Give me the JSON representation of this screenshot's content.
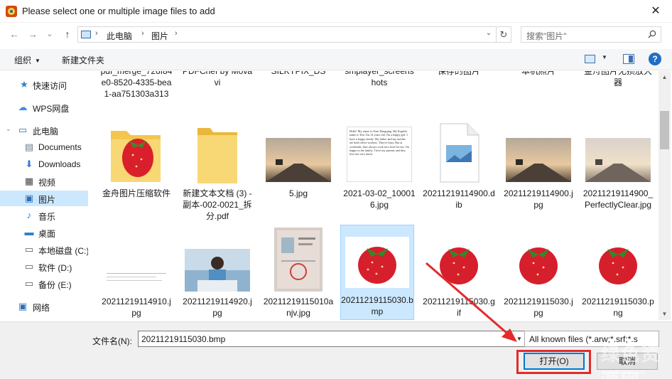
{
  "window": {
    "title": "Please select one or multiple image files to add",
    "close_symbol": "✕"
  },
  "nav": {
    "back_symbol": "←",
    "forward_symbol": "→",
    "recent_symbol": "⌄",
    "up_symbol": "↑",
    "breadcrumb": [
      "此电脑",
      "图片"
    ],
    "breadcrumb_sep": "›",
    "refresh_symbol": "↻",
    "dropdown_symbol": "⌄",
    "search_placeholder": "搜索\"图片\""
  },
  "toolbar": {
    "organize_label": "组织",
    "organize_caret": "▼",
    "new_folder_label": "新建文件夹",
    "view_dd_symbol": "▼",
    "help_symbol": "?"
  },
  "sidebar": {
    "items": [
      {
        "label": "快速访问",
        "icon": "star-icon",
        "glyph": "★"
      },
      {
        "label": "WPS网盘",
        "icon": "cloud-icon",
        "glyph": "☁"
      },
      {
        "label": "此电脑",
        "icon": "computer-icon",
        "glyph": "▭",
        "expand": "⌄"
      },
      {
        "label": "Documents",
        "icon": "documents-icon",
        "glyph": "▤"
      },
      {
        "label": "Downloads",
        "icon": "download-icon",
        "glyph": "⬇"
      },
      {
        "label": "视频",
        "icon": "video-icon",
        "glyph": "▦"
      },
      {
        "label": "图片",
        "icon": "pictures-icon",
        "glyph": "▣",
        "selected": true
      },
      {
        "label": "音乐",
        "icon": "music-icon",
        "glyph": "♪"
      },
      {
        "label": "桌面",
        "icon": "desktop-icon",
        "glyph": "▬"
      },
      {
        "label": "本地磁盘 (C:)",
        "icon": "drive-c-icon",
        "glyph": "▭"
      },
      {
        "label": "软件 (D:)",
        "icon": "drive-d-icon",
        "glyph": "▭"
      },
      {
        "label": "备份 (E:)",
        "icon": "drive-e-icon",
        "glyph": "▭"
      },
      {
        "label": "网络",
        "icon": "network-icon",
        "glyph": "▣"
      }
    ]
  },
  "files": {
    "partial_row": [
      {
        "name": "pdf_merge_726f84e0-8520-4335-bea1-aa751303a313"
      },
      {
        "name": "PDFChef by Movavi"
      },
      {
        "name": "SILKYPIX_DS"
      },
      {
        "name": "smplayer_screenshots"
      },
      {
        "name": "保存的图片"
      },
      {
        "name": "本机照片"
      },
      {
        "name": "金舟图片无损放大器"
      }
    ],
    "row1": [
      {
        "name": "金舟图片压缩软件",
        "kind": "folder-strawberry"
      },
      {
        "name": "新建文本文档 (3) - 副本-002-0021_拆分.pdf",
        "kind": "folder"
      },
      {
        "name": "5.jpg",
        "kind": "road"
      },
      {
        "name": "2021-03-02_100016.jpg",
        "kind": "document"
      },
      {
        "name": "20211219114900.dib",
        "kind": "dib"
      },
      {
        "name": "20211219114900.jpg",
        "kind": "road"
      },
      {
        "name": "20211219114900_PerfectlyClear.jpg",
        "kind": "road-light"
      }
    ],
    "row2": [
      {
        "name": "20211219114910.jpg",
        "kind": "blank-doc"
      },
      {
        "name": "20211219114920.jpg",
        "kind": "person"
      },
      {
        "name": "20211219115010anjv.jpg",
        "kind": "passport"
      },
      {
        "name": "20211219115030.bmp",
        "kind": "strawberry",
        "selected": true
      },
      {
        "name": "20211219115030.gif",
        "kind": "strawberry"
      },
      {
        "name": "20211219115030.jpg",
        "kind": "strawberry"
      },
      {
        "name": "20211219115030.png",
        "kind": "strawberry"
      }
    ],
    "doc_thumb_text": "Hello! My name is Chen Dangqing. My English name is Tim. I'm 14 years old. I'm a happy girl. I have a happy family. My father and my mother are both office workers. They're busy. But at weekends, they always cook nice food for me. I'm happy in the family. I love my parents and they love me very much."
  },
  "bottom": {
    "filename_label": "文件名(N):",
    "filename_value": "20211219115030.bmp",
    "filetype_value": "All known files (*.arw;*.srf;*.s",
    "open_label": "打开(O)",
    "cancel_label": "取消",
    "dd_symbol": "▼"
  },
  "watermark": {
    "text": "绿色资源网",
    "sub": "www.downcc.com"
  },
  "scrollbar": {
    "up": "▲",
    "down": "▼"
  }
}
